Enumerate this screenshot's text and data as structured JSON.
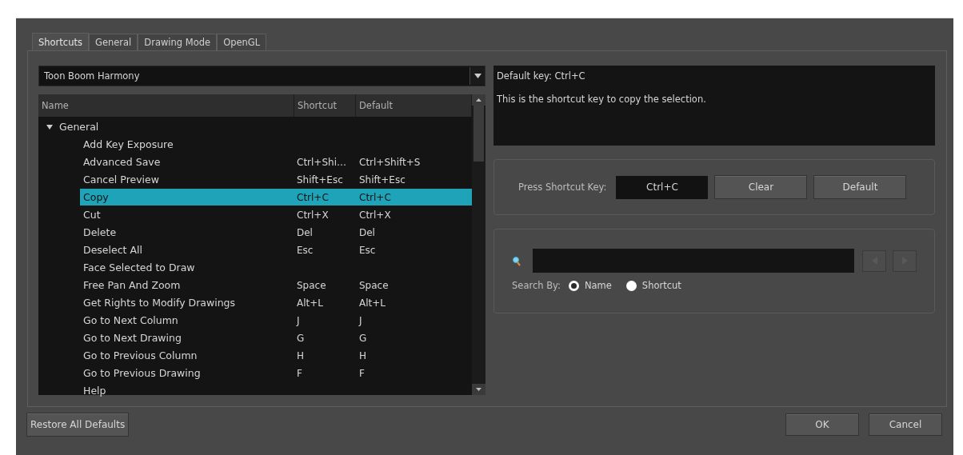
{
  "tabs": [
    {
      "label": "Shortcuts",
      "selected": true
    },
    {
      "label": "General",
      "selected": false
    },
    {
      "label": "Drawing Mode",
      "selected": false
    },
    {
      "label": "OpenGL",
      "selected": false
    }
  ],
  "keyset": {
    "value": "Toon Boom Harmony"
  },
  "table": {
    "columns": [
      "Name",
      "Shortcut",
      "Default"
    ],
    "rows": [
      {
        "name": "General",
        "expanded": true,
        "selected": false,
        "children": [
          {
            "name": "Add Key Exposure",
            "selected": false
          },
          {
            "name": "Advanced Save",
            "shortcut": "Ctrl+Shi…",
            "default": "Ctrl+Shift+S",
            "selected": false
          },
          {
            "name": "Cancel Preview",
            "shortcut": "Shift+Esc",
            "default": "Shift+Esc",
            "selected": false
          },
          {
            "name": "Copy",
            "shortcut": "Ctrl+C",
            "default": "Ctrl+C",
            "selected": true
          },
          {
            "name": "Cut",
            "shortcut": "Ctrl+X",
            "default": "Ctrl+X",
            "selected": false
          },
          {
            "name": "Delete",
            "shortcut": "Del",
            "default": "Del",
            "selected": false
          },
          {
            "name": "Deselect All",
            "shortcut": "Esc",
            "default": "Esc",
            "selected": false
          },
          {
            "name": "Face Selected to Draw",
            "selected": false
          },
          {
            "name": "Free Pan And Zoom",
            "shortcut": "Space",
            "default": "Space",
            "selected": false
          },
          {
            "name": "Get Rights to Modify Drawings",
            "shortcut": "Alt+L",
            "default": "Alt+L",
            "selected": false
          },
          {
            "name": "Go to Next Column",
            "shortcut": "J",
            "default": "J",
            "selected": false
          },
          {
            "name": "Go to Next Drawing",
            "shortcut": "G",
            "default": "G",
            "selected": false
          },
          {
            "name": "Go to Previous Column",
            "shortcut": "H",
            "default": "H",
            "selected": false
          },
          {
            "name": "Go to Previous Drawing",
            "shortcut": "F",
            "default": "F",
            "selected": false
          },
          {
            "name": "Help",
            "selected": false
          }
        ]
      }
    ]
  },
  "description": {
    "default_key": "Default key: Ctrl+C",
    "text": "This is the shortcut key to copy the selection."
  },
  "shortcut_group": {
    "label": "Press Shortcut Key:",
    "value": "Ctrl+C",
    "buttons": [
      "Clear",
      "Default"
    ]
  },
  "search": {
    "label": "Search By:",
    "options": [
      {
        "label": "Name",
        "selected": true
      },
      {
        "label": "Shortcut",
        "selected": false
      }
    ]
  },
  "footer": {
    "restore": "Restore All Defaults",
    "buttons": [
      "OK",
      "Cancel"
    ]
  }
}
